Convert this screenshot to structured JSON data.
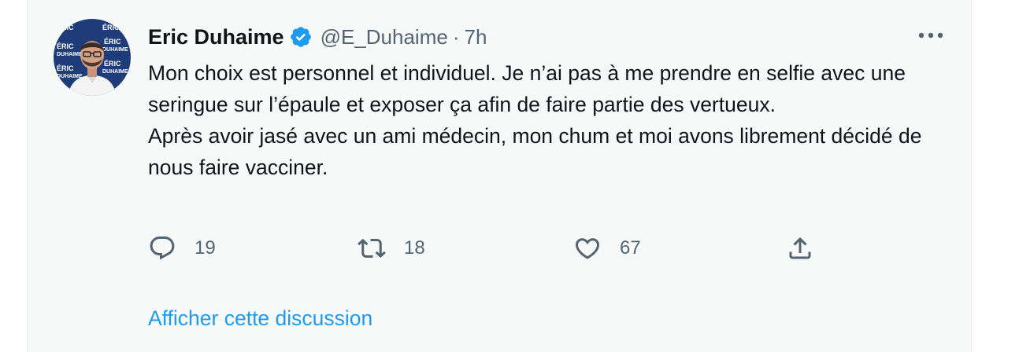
{
  "tweet": {
    "author": {
      "display_name": "Eric Duhaime",
      "handle": "@E_Duhaime",
      "separator": "·",
      "time": "7h",
      "verified": true,
      "avatar_backdrop_text": [
        "ÉRIC",
        "DUHAIME"
      ]
    },
    "text_lines": [
      "Mon choix est personnel et individuel. Je n’ai pas à me prendre en selfie avec une seringue sur l’épaule et exposer ça afin de faire partie des vertueux.",
      "Après avoir jasé avec un ami médecin, mon chum et moi avons librement décidé de nous faire vacciner."
    ],
    "actions": {
      "reply_count": "19",
      "retweet_count": "18",
      "like_count": "67"
    },
    "show_thread_label": "Afficher cette discussion"
  },
  "icons": {
    "verified": "verified-badge-icon",
    "more": "more-horizontal-icon",
    "reply": "reply-icon",
    "retweet": "retweet-icon",
    "like": "heart-icon",
    "share": "share-icon"
  },
  "colors": {
    "accent": "#1d9bf0",
    "secondary_text": "#536471",
    "card_background": "#f7f9f9"
  }
}
